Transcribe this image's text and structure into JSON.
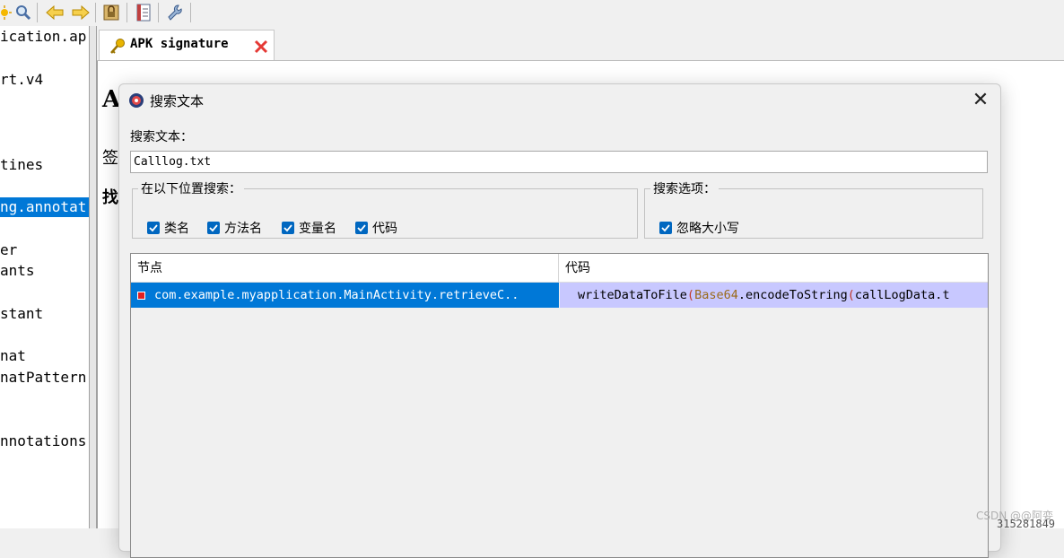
{
  "toolbar": {
    "icons": [
      "sun-icon",
      "search-icon",
      "back-arrow-icon",
      "forward-arrow-icon",
      "lock-icon",
      "log-icon",
      "wrench-icon"
    ]
  },
  "tree": {
    "items": [
      {
        "label": "ication.ap",
        "selected": false
      },
      {
        "label": "rt.v4",
        "selected": false
      },
      {
        "label": "tines",
        "selected": false
      },
      {
        "label": "ng.annotat",
        "selected": true
      },
      {
        "label": "er",
        "selected": false
      },
      {
        "label": "ants",
        "selected": false
      },
      {
        "label": "stant",
        "selected": false
      },
      {
        "label": "nat",
        "selected": false
      },
      {
        "label": "natPattern",
        "selected": false
      },
      {
        "label": "nnotations",
        "selected": false
      }
    ]
  },
  "tab": {
    "label": "APK signature"
  },
  "background": {
    "chars": [
      "A",
      "签",
      "找"
    ]
  },
  "dialog": {
    "title": "搜索文本",
    "search_label": "搜索文本：",
    "search_value": "Calllog.txt",
    "location_group": {
      "legend": "在以下位置搜索：",
      "options": [
        {
          "label": "类名",
          "checked": true
        },
        {
          "label": "方法名",
          "checked": true
        },
        {
          "label": "变量名",
          "checked": true
        },
        {
          "label": "代码",
          "checked": true
        }
      ]
    },
    "options_group": {
      "legend": "搜索选项：",
      "options": [
        {
          "label": "忽略大小写",
          "checked": true
        }
      ]
    },
    "results": {
      "columns": [
        "节点",
        "代码"
      ],
      "rows": [
        {
          "node": "com.example.myapplication.MainActivity.retrieveC..",
          "code": {
            "func": "writeDataToFile",
            "cls": "Base64",
            "mid": ".encodeToString",
            "arg": "callLogData.t"
          }
        }
      ]
    }
  },
  "footer": {
    "watermark": "CSDN @@阿娈",
    "edge_number": "315281849"
  },
  "colors": {
    "accent": "#0078d7",
    "code_highlight": "#c8c8ff",
    "close_red": "#e53935"
  }
}
